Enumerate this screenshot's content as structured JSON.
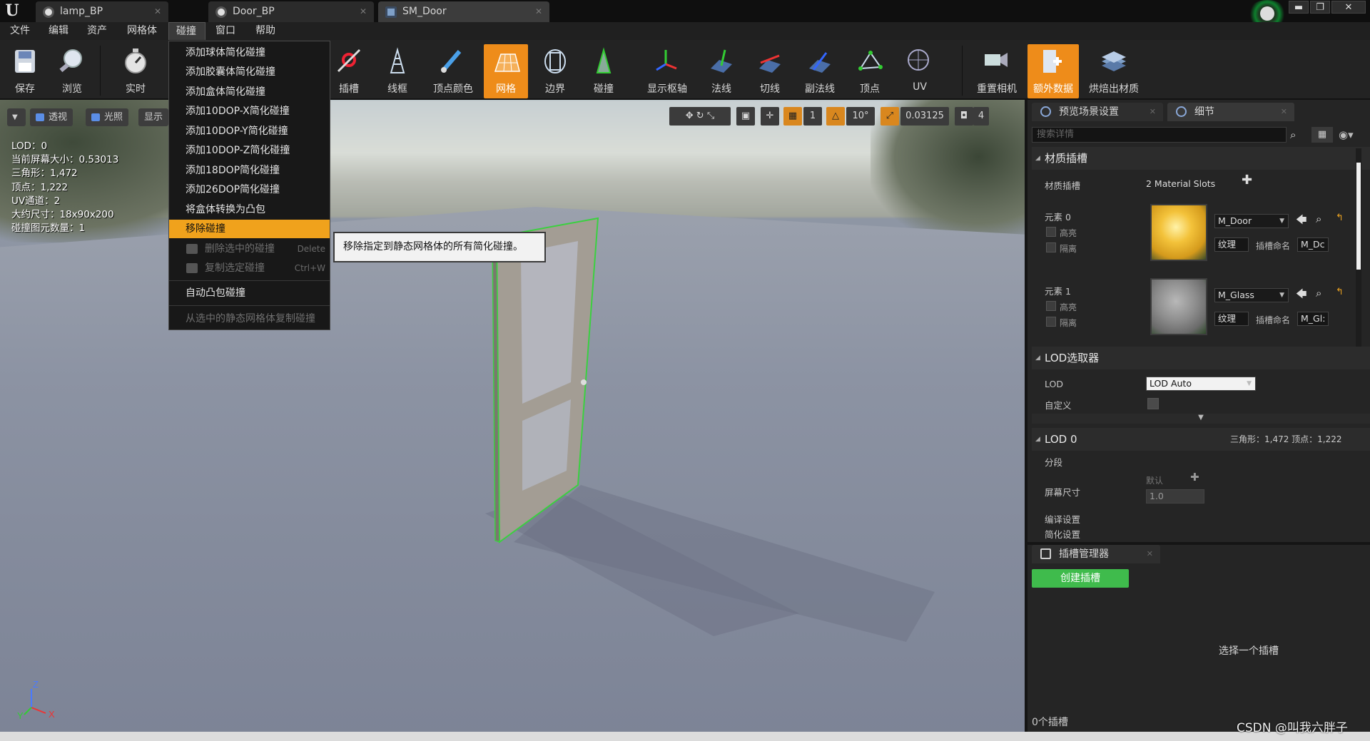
{
  "title_bar": {
    "tabs": [
      {
        "label": "lamp_BP",
        "icon": "blueprint-icon"
      },
      {
        "label": "Door_BP",
        "icon": "blueprint-icon"
      },
      {
        "label": "SM_Door",
        "icon": "static-mesh-icon"
      }
    ],
    "window_buttons": {
      "minimize": "▬",
      "restore": "❐",
      "close": "✕"
    }
  },
  "menubar": {
    "items": [
      "文件",
      "编辑",
      "资产",
      "网格体",
      "碰撞",
      "窗口",
      "帮助"
    ]
  },
  "toolbar": {
    "buttons": [
      {
        "label": "保存",
        "icon": "save-icon"
      },
      {
        "label": "浏览",
        "icon": "browse-icon"
      },
      {
        "label": "实时",
        "icon": "realtime-icon"
      },
      {
        "label": "插槽",
        "icon": "sockets-icon"
      },
      {
        "label": "线框",
        "icon": "wireframe-icon"
      },
      {
        "label": "顶点颜色",
        "icon": "vertex-color-icon"
      },
      {
        "label": "网格",
        "icon": "grid-icon"
      },
      {
        "label": "边界",
        "icon": "bounds-icon"
      },
      {
        "label": "碰撞",
        "icon": "collision-icon"
      },
      {
        "label": "显示枢轴",
        "icon": "pivot-icon"
      },
      {
        "label": "法线",
        "icon": "normals-icon"
      },
      {
        "label": "切线",
        "icon": "tangents-icon"
      },
      {
        "label": "副法线",
        "icon": "binormals-icon"
      },
      {
        "label": "顶点",
        "icon": "vertices-icon"
      },
      {
        "label": "UV",
        "icon": "uv-icon"
      },
      {
        "label": "重置相机",
        "icon": "reset-camera-icon"
      },
      {
        "label": "额外数据",
        "icon": "additional-data-icon"
      },
      {
        "label": "烘焙出材质",
        "icon": "bake-material-icon"
      }
    ]
  },
  "viewport": {
    "buttons": {
      "perspective": "透视",
      "lit": "光照",
      "show": "显示"
    },
    "stats": [
      "LOD：0",
      "当前屏幕大小：0.53013",
      "三角形：1,472",
      "顶点：1,222",
      "UV通道：2",
      "大约尺寸：18x90x200",
      "碰撞图元数量：1"
    ],
    "snap": {
      "grid_value": "1",
      "rotation": "10°",
      "scale": "0.03125",
      "camera_speed": "4"
    },
    "axes": {
      "x": "X",
      "y": "Y",
      "z": "Z"
    }
  },
  "collision_menu": {
    "items": [
      "添加球体简化碰撞",
      "添加胶囊体简化碰撞",
      "添加盒体简化碰撞",
      "添加10DOP-X简化碰撞",
      "添加10DOP-Y简化碰撞",
      "添加10DOP-Z简化碰撞",
      "添加18DOP简化碰撞",
      "添加26DOP简化碰撞",
      "将盒体转换为凸包",
      "移除碰撞"
    ],
    "disabled": [
      {
        "label": "删除选中的碰撞",
        "shortcut": "Delete"
      },
      {
        "label": "复制选定碰撞",
        "shortcut": "Ctrl+W"
      }
    ],
    "auto_convex": "自动凸包碰撞",
    "copy_from_selected": "从选中的静态网格体复制碰撞",
    "tooltip": "移除指定到静态网格体的所有简化碰撞。"
  },
  "details": {
    "tabs": [
      "预览场景设置",
      "细节"
    ],
    "search_placeholder": "搜索详情",
    "material_slots": {
      "header": "材质插槽",
      "label": "材质插槽",
      "value": "2 Material Slots",
      "elements": [
        {
          "name": "元素 0",
          "material": "M_Door",
          "highlight": "高亮",
          "isolate": "隔离",
          "texture": "纹理",
          "slot_name_label": "插槽命名",
          "slot_name": "M_Dc"
        },
        {
          "name": "元素 1",
          "material": "M_Glass",
          "highlight": "高亮",
          "isolate": "隔离",
          "texture": "纹理",
          "slot_name_label": "插槽命名",
          "slot_name": "M_Gl:"
        }
      ]
    },
    "lod_picker": {
      "header": "LOD选取器",
      "lod_label": "LOD",
      "lod_value": "LOD Auto",
      "custom_label": "自定义"
    },
    "lod0": {
      "header": "LOD 0",
      "summary": "三角形：1,472   顶点：1,222",
      "sections": "分段",
      "screen_size_label": "屏幕尺寸",
      "default_label": "默认",
      "screen_size_value": "1.0",
      "build_settings": "编译设置",
      "reduction_settings": "简化设置"
    }
  },
  "socket_manager": {
    "tab": "插槽管理器",
    "create_button": "创建插槽",
    "empty_text": "选择一个插槽",
    "count": "0个插槽"
  },
  "watermark": "CSDN @叫我六胖子",
  "colors": {
    "accent_orange": "#ee8c1a",
    "menu_highlight": "#f0a21c",
    "create_green": "#3fbb4c",
    "panel_bg": "#252525"
  }
}
